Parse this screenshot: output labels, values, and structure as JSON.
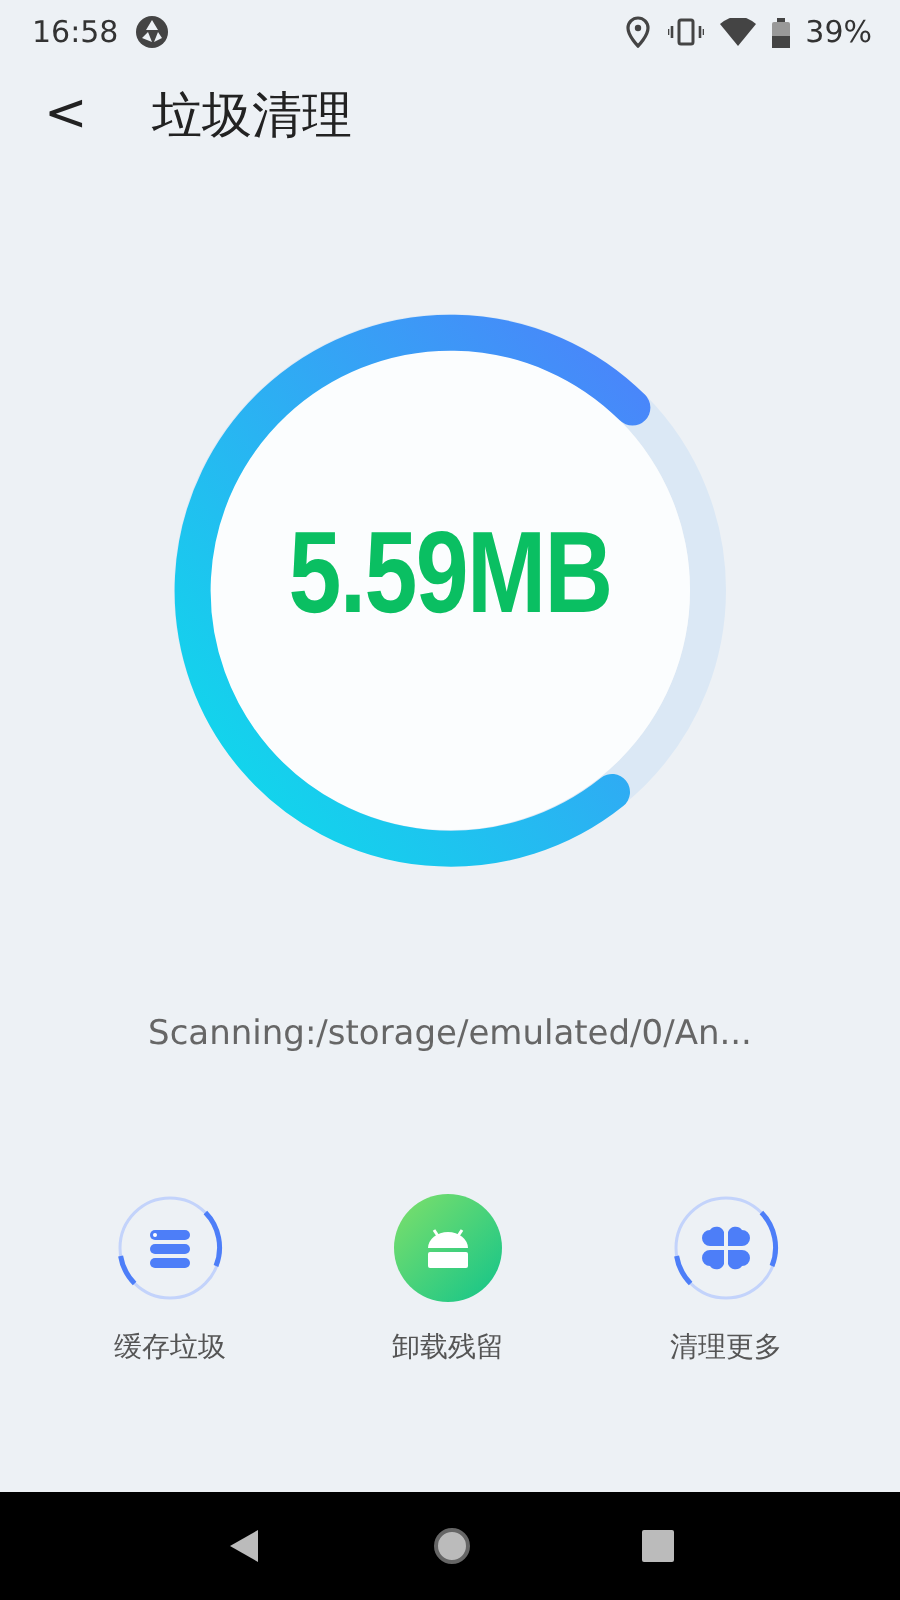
{
  "status_bar": {
    "time": "16:58",
    "battery": "39%"
  },
  "header": {
    "back": "<",
    "title": "垃圾清理"
  },
  "scan": {
    "size": "5.59MB",
    "path": "Scanning:/storage/emulated/0/An..."
  },
  "actions": [
    {
      "label": "缓存垃圾",
      "kind": "ring"
    },
    {
      "label": "卸载残留",
      "kind": "filled"
    },
    {
      "label": "清理更多",
      "kind": "ring"
    }
  ]
}
